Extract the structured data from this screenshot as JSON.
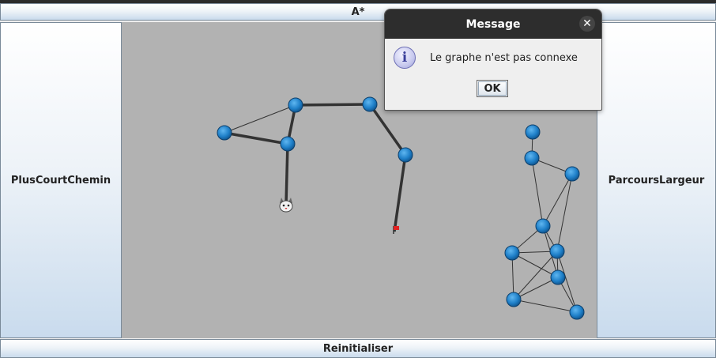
{
  "buttons": {
    "top": "A*",
    "left": "PlusCourtChemin",
    "right": "ParcoursLargeur",
    "bottom": "Reinitialiser"
  },
  "dialog": {
    "title": "Message",
    "message": "Le graphe n'est pas connexe",
    "ok_label": "OK",
    "close_icon": "close-icon",
    "info_icon": "info-icon"
  },
  "graph": {
    "node_color": "#1e7fc8",
    "start_marker": "cat-icon",
    "goal_marker": "red-flag-icon"
  }
}
